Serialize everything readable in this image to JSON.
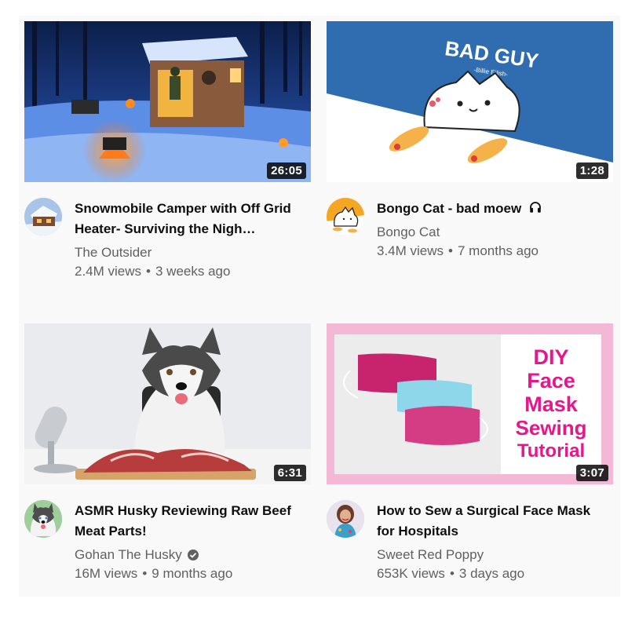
{
  "videos": [
    {
      "title": "Snowmobile Camper with Off Grid Heater- Surviving the Nigh…",
      "channel": "The Outsider",
      "views": "2.4M views",
      "age": "3 weeks ago",
      "duration": "26:05"
    },
    {
      "title": "Bongo Cat - bad moew",
      "channel": "Bongo Cat",
      "views": "3.4M views",
      "age": "7 months ago",
      "duration": "1:28",
      "thumb_text": "BAD GUY",
      "thumb_subtext": "-Billie Eilish-"
    },
    {
      "title": "ASMR Husky Reviewing Raw Beef Meat Parts!",
      "channel": "Gohan The Husky",
      "views": "16M views",
      "age": "9 months ago",
      "duration": "6:31",
      "verified": true
    },
    {
      "title": "How to Sew a Surgical Face Mask for Hospitals",
      "channel": "Sweet Red Poppy",
      "views": "653K views",
      "age": "3 days ago",
      "duration": "3:07",
      "thumb_lines": [
        "DIY",
        "Face",
        "Mask",
        "Sewing",
        "Tutorial"
      ]
    }
  ],
  "separator": "•",
  "icons": {
    "verified": "verified-check-icon",
    "headphones": "headphones-icon"
  },
  "colors": {
    "title": "#0f0f0f",
    "meta": "#606060",
    "duration_bg": "#000000",
    "bongo_blue": "#2f6db0",
    "diy_pink": "#e8168c"
  }
}
